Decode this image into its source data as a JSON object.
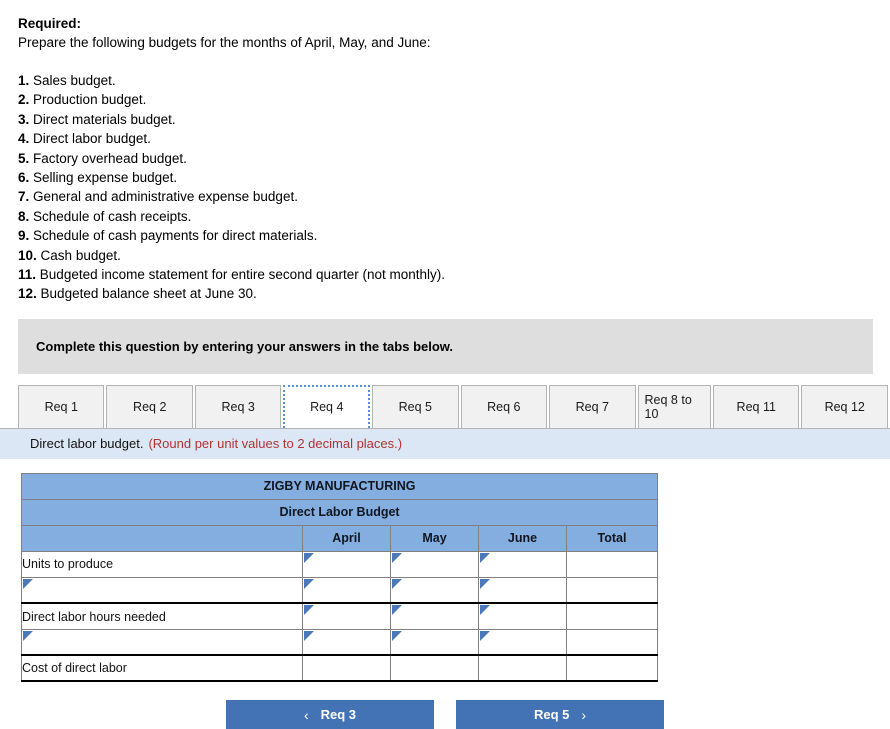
{
  "requirements": {
    "heading": "Required:",
    "intro": "Prepare the following budgets for the months of April, May, and June:",
    "items": [
      {
        "num": "1.",
        "text": "Sales budget."
      },
      {
        "num": "2.",
        "text": "Production budget."
      },
      {
        "num": "3.",
        "text": "Direct materials budget."
      },
      {
        "num": "4.",
        "text": "Direct labor budget."
      },
      {
        "num": "5.",
        "text": "Factory overhead budget."
      },
      {
        "num": "6.",
        "text": "Selling expense budget."
      },
      {
        "num": "7.",
        "text": "General and administrative expense budget."
      },
      {
        "num": "8.",
        "text": "Schedule of cash receipts."
      },
      {
        "num": "9.",
        "text": "Schedule of cash payments for direct materials."
      },
      {
        "num": "10.",
        "text": "Cash budget."
      },
      {
        "num": "11.",
        "text": "Budgeted income statement for entire second quarter (not monthly)."
      },
      {
        "num": "12.",
        "text": "Budgeted balance sheet at June 30."
      }
    ]
  },
  "banner": {
    "text": "Complete this question by entering your answers in the tabs below."
  },
  "tabs": {
    "items": [
      {
        "label": "Req 1",
        "active": false
      },
      {
        "label": "Req 2",
        "active": false
      },
      {
        "label": "Req 3",
        "active": false
      },
      {
        "label": "Req 4",
        "active": true
      },
      {
        "label": "Req 5",
        "active": false
      },
      {
        "label": "Req 6",
        "active": false
      },
      {
        "label": "Req 7",
        "active": false
      },
      {
        "label": "Req 8 to 10",
        "active": false
      },
      {
        "label": "Req 11",
        "active": false
      },
      {
        "label": "Req 12",
        "active": false
      }
    ]
  },
  "subbanner": {
    "main": "Direct labor budget.",
    "note": "(Round per unit values to 2 decimal places.)"
  },
  "table": {
    "company": "ZIGBY MANUFACTURING",
    "title": "Direct Labor Budget",
    "corner_header": "",
    "columns": [
      "April",
      "May",
      "June",
      "Total"
    ],
    "rows": [
      {
        "label": "Units to produce",
        "label_editable": false,
        "label_value": "",
        "cells": [
          "",
          "",
          ""
        ],
        "total": "",
        "total_editable": false,
        "thick_bottom": false
      },
      {
        "label": "",
        "label_editable": true,
        "label_value": "",
        "cells": [
          "",
          "",
          ""
        ],
        "total": "",
        "total_editable": false,
        "thick_bottom": true
      },
      {
        "label": "Direct labor hours needed",
        "label_editable": false,
        "label_value": "",
        "cells": [
          "",
          "",
          ""
        ],
        "total": "",
        "total_editable": false,
        "thick_bottom": false
      },
      {
        "label": "",
        "label_editable": true,
        "label_value": "",
        "cells": [
          "",
          "",
          ""
        ],
        "total": "",
        "total_editable": false,
        "thick_bottom": true
      },
      {
        "label": "Cost of direct labor",
        "label_editable": false,
        "label_value": "",
        "cells": [
          "",
          "",
          ""
        ],
        "total": "",
        "total_editable": false,
        "thick_bottom": true,
        "plain_cells": true
      }
    ]
  },
  "nav": {
    "prev_label": "Req 3",
    "prev_chevron": "‹",
    "next_label": "Req 5",
    "next_chevron": "›"
  },
  "colors": {
    "header_blue": "#85aee0",
    "button_blue": "#4473b5",
    "info_blue": "#dce7f5",
    "banner_gray": "#dedede",
    "note_red": "#b03232",
    "marker_blue": "#4a78b8"
  }
}
